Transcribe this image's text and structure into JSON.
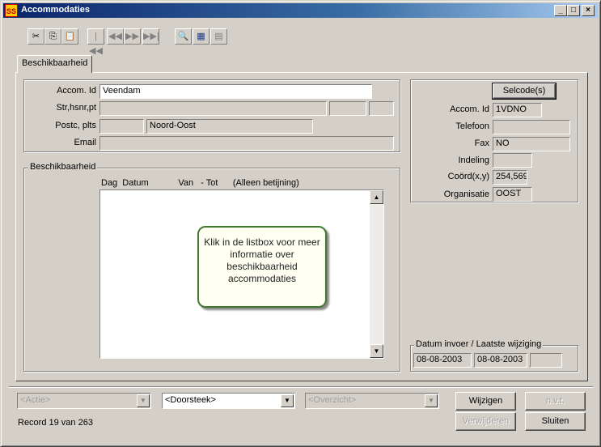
{
  "window": {
    "title": "Accommodaties",
    "app_icon_text": "SS",
    "controls": {
      "minimize": "_",
      "maximize": "□",
      "close": "×"
    }
  },
  "toolbar": {
    "icons": [
      "cut-icon",
      "copy-icon",
      "paste-icon",
      "first-record-icon",
      "prev-record-icon",
      "next-record-icon",
      "last-record-icon",
      "search-icon",
      "grid-icon",
      "form-icon"
    ]
  },
  "tabs": [
    {
      "label": "Beschikbaarheid"
    }
  ],
  "address": {
    "accom_id_label": "Accom. Id",
    "accom_id_value": "Veendam",
    "street_label": "Str,hsnr,pt",
    "street_value": "",
    "postcode_label": "Postc, plts",
    "postcode_value": "",
    "place_value": "Noord-Oost",
    "email_label": "Email",
    "email_value": ""
  },
  "availability": {
    "legend": "Beschikbaarheid",
    "columns_header": "Dag  Datum            Van   - Tot      (Alleen betijning)",
    "callout": "Klik in de listbox voor meer informatie over beschikbaarheid accommodaties"
  },
  "details": {
    "selcode_button": "Selcode(s)",
    "accom_id_label": "Accom. Id",
    "accom_id_value": "1VDNO",
    "telefoon_label": "Telefoon",
    "telefoon_value": "",
    "fax_label": "Fax",
    "fax_value": "NO",
    "indeling_label": "Indeling",
    "indeling_value": "",
    "coord_label": "Coörd(x,y)",
    "coord_value": "254,569",
    "organisatie_label": "Organisatie",
    "organisatie_value": "OOST"
  },
  "dates": {
    "legend": "Datum invoer / Laatste wijziging",
    "invoer": "08-08-2003",
    "wijziging": "08-08-2003",
    "extra": ""
  },
  "bottom": {
    "actie_combo": "<Actie>",
    "doorsteek_combo": "<Doorsteek>",
    "overzicht_combo": "<Overzicht>",
    "wijzigen_button": "Wijzigen",
    "nvt_button": "n.v.t.",
    "verwijderen_button": "Verwijderen",
    "sluiten_button": "Sluiten",
    "record_status": "Record 19 van 263"
  }
}
